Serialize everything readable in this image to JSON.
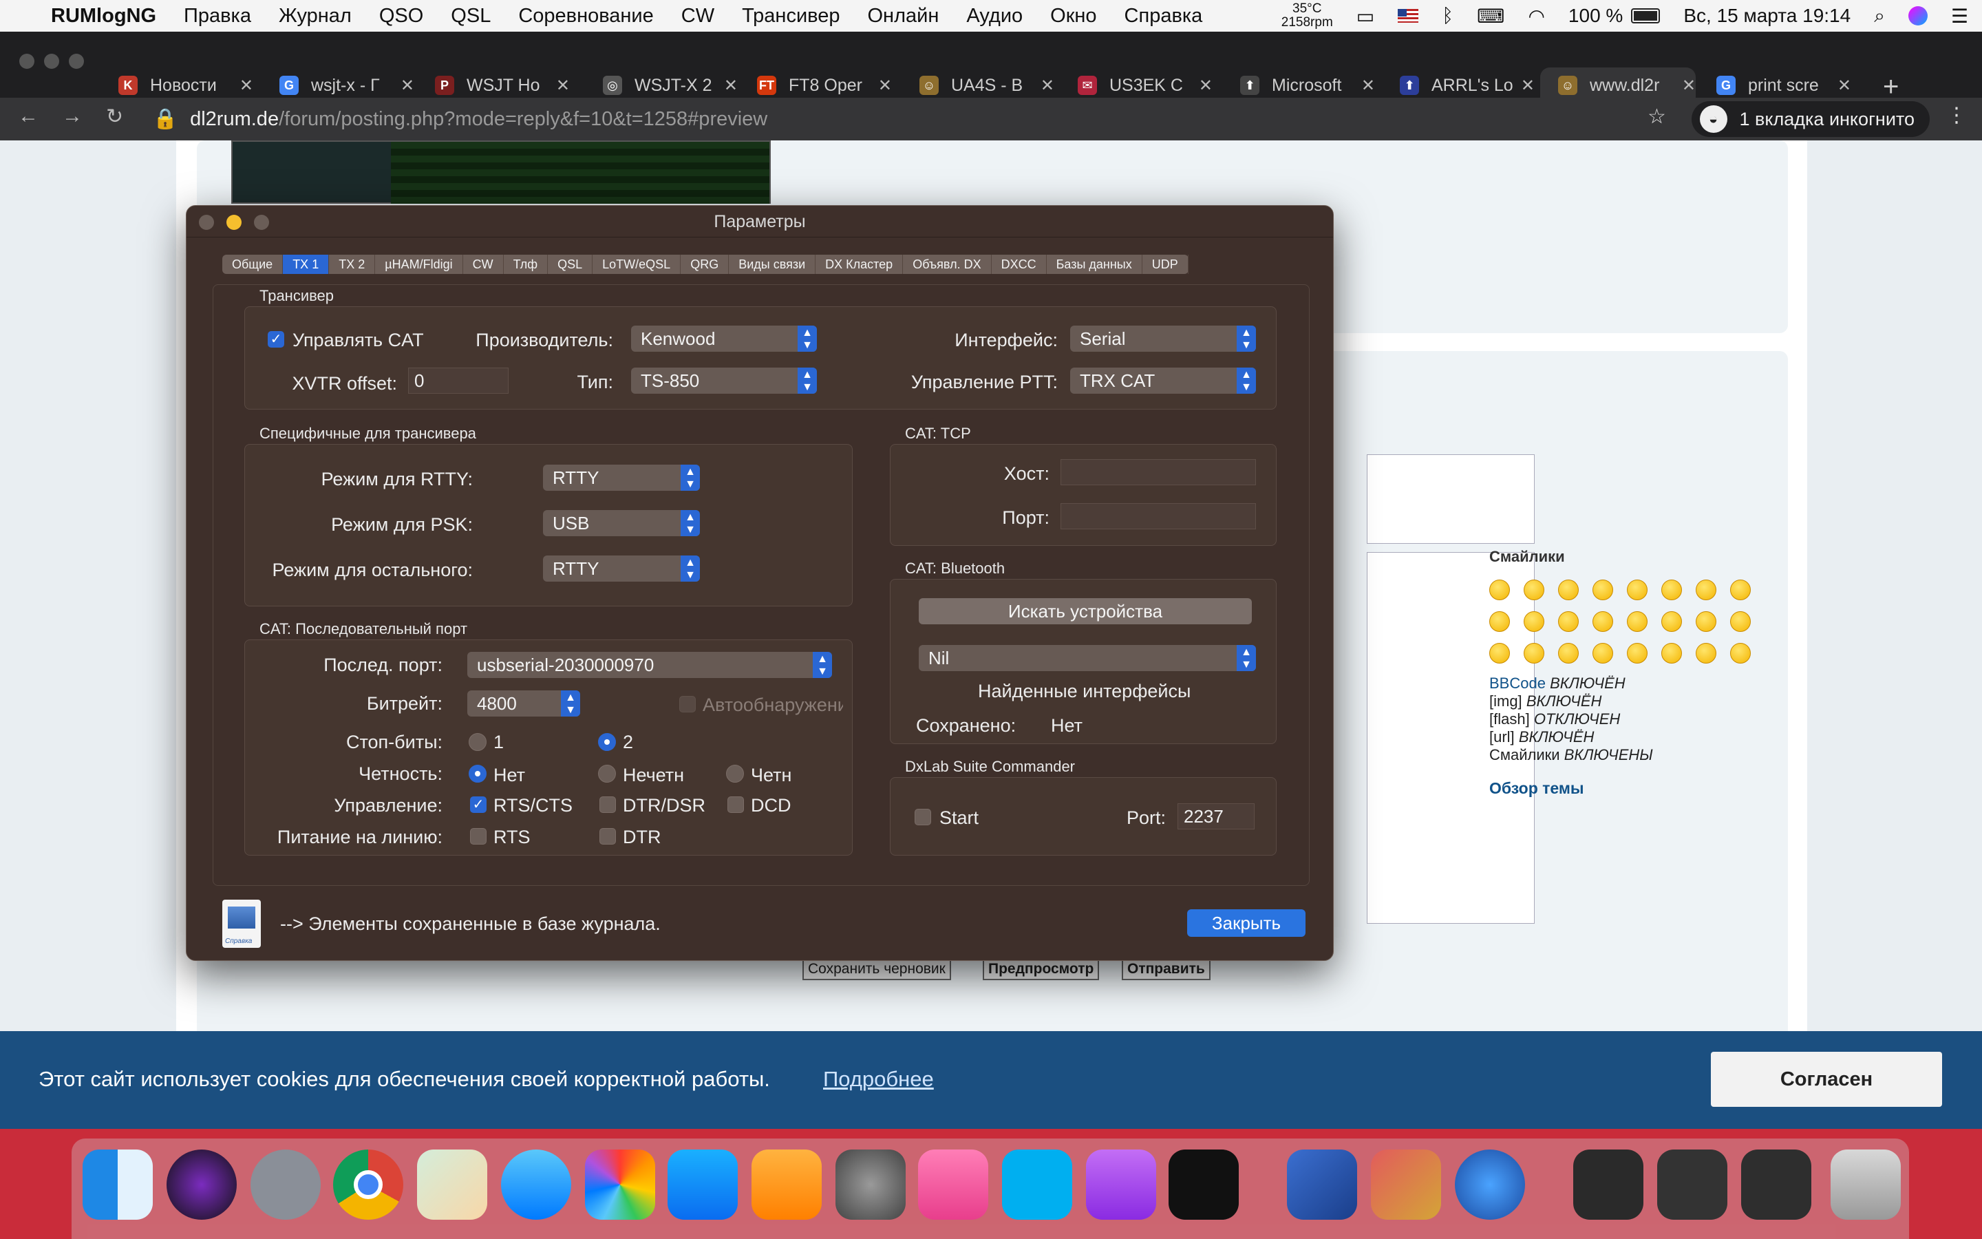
{
  "menubar": {
    "app": "RUMlogNG",
    "items": [
      "Правка",
      "Журнал",
      "QSO",
      "QSL",
      "Соревнование",
      "CW",
      "Трансивер",
      "Онлайн",
      "Аудио",
      "Окно",
      "Справка"
    ],
    "temp": "35°C",
    "rpm": "2158rpm",
    "battery": "100 %",
    "datetime": "Вс, 15 марта  19:14"
  },
  "tabs": [
    {
      "label": "Новости",
      "favicon": "K",
      "color": "#c0392b"
    },
    {
      "label": "wsjt-x - Г",
      "favicon": "G",
      "color": "#4285f4"
    },
    {
      "label": "WSJT Ho",
      "favicon": "P",
      "color": "#7a1f1f"
    },
    {
      "label": "WSJT-X 2",
      "favicon": "◎",
      "color": "#555"
    },
    {
      "label": "FT8 Oper",
      "favicon": "FT",
      "color": "#d4380d"
    },
    {
      "label": "UA4S - B",
      "favicon": "☺",
      "color": "#8e6e2e"
    },
    {
      "label": "US3EK C",
      "favicon": "✉",
      "color": "#b0243c"
    },
    {
      "label": "Microsoft",
      "favicon": "⬆",
      "color": "#444"
    },
    {
      "label": "ARRL's Lo",
      "favicon": "⬆",
      "color": "#2c3e9a"
    },
    {
      "label": "www.dl2r",
      "favicon": "☺",
      "color": "#8e6e2e"
    },
    {
      "label": "print scre",
      "favicon": "G",
      "color": "#4285f4"
    }
  ],
  "address": {
    "domain": "dl2rum.de",
    "path": "/forum/posting.php?mode=reply&f=10&t=1258#preview",
    "incognito": "1 вкладка инкогнито"
  },
  "forum": {
    "smileys_title": "Смайлики",
    "bbcode": "BBCode",
    "bbcode_state": "ВКЛЮЧЁН",
    "img": "[img]",
    "img_state": "ВКЛЮЧЁН",
    "flash": "[flash]",
    "flash_state": "ОТКЛЮЧЕН",
    "url": "[url]",
    "url_state": "ВКЛЮЧЁН",
    "smileys": "Смайлики",
    "smileys_state": "ВКЛЮЧЕНЫ",
    "topic_review": "Обзор темы",
    "save_draft": "Сохранить черновик",
    "preview": "Предпросмотр",
    "submit": "Отправить"
  },
  "cookie": {
    "text": "Этот сайт использует cookies для обеспечения своей корректной работы.",
    "more": "Подробнее",
    "accept": "Согласен"
  },
  "dialog": {
    "title": "Параметры",
    "tabs": [
      "Общие",
      "TX 1",
      "TX 2",
      "µHAM/Fldigi",
      "CW",
      "Тлф",
      "QSL",
      "LoTW/eQSL",
      "QRG",
      "Виды связи",
      "DX Кластер",
      "Объявл. DX",
      "DXCC",
      "Базы данных",
      "UDP"
    ],
    "active_tab": "TX 1",
    "transceiver": {
      "title": "Трансивер",
      "cat_label": "Управлять CAT",
      "cat_checked": true,
      "manufacturer_label": "Производитель:",
      "manufacturer": "Kenwood",
      "interface_label": "Интерфейс:",
      "interface": "Serial",
      "xvtr_label": "XVTR offset:",
      "xvtr": "0",
      "type_label": "Тип:",
      "type": "TS-850",
      "ptt_label": "Управление PTT:",
      "ptt": "TRX CAT"
    },
    "specific": {
      "title": "Специфичные для трансивера",
      "rtty_label": "Режим для RTTY:",
      "rtty": "RTTY",
      "psk_label": "Режим для PSK:",
      "psk": "USB",
      "other_label": "Режим для остального:",
      "other": "RTTY"
    },
    "tcp": {
      "title": "CAT: TCP",
      "host_label": "Хост:",
      "host": "",
      "port_label": "Порт:",
      "port": ""
    },
    "bluetooth": {
      "title": "CAT: Bluetooth",
      "search": "Искать устройства",
      "device": "Nil",
      "found": "Найденные интерфейсы",
      "saved_label": "Сохранено:",
      "saved": "Нет"
    },
    "serial": {
      "title": "CAT: Последовательный порт",
      "port_label": "Послед. порт:",
      "port": "usbserial-2030000970",
      "baud_label": "Битрейт:",
      "baud": "4800",
      "auto": "Автообнаружени",
      "stop_label": "Стоп-биты:",
      "stop_1": "1",
      "stop_2": "2",
      "parity_label": "Четность:",
      "parity_none": "Нет",
      "parity_odd": "Нечетн",
      "parity_even": "Четн",
      "flow_label": "Управление:",
      "rtscts": "RTS/CTS",
      "dtrdsr": "DTR/DSR",
      "dcd": "DCD",
      "power_label": "Питание на линию:",
      "rts": "RTS",
      "dtr": "DTR"
    },
    "dxlab": {
      "title": "DxLab Suite Commander",
      "start": "Start",
      "port_label": "Port:",
      "port": "2237"
    },
    "footer_note": "--> Элементы сохраненные в базе журнала.",
    "help_label": "Справка",
    "close": "Закрыть"
  }
}
